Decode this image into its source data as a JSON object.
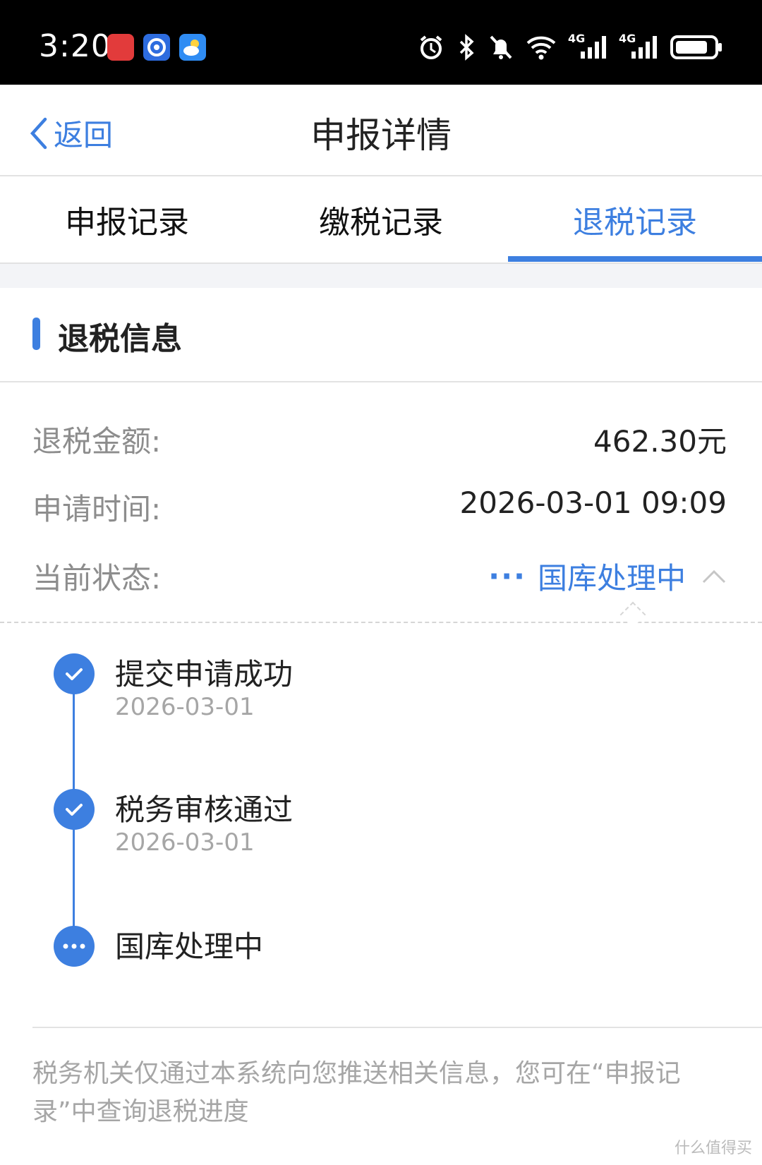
{
  "status_bar": {
    "time": "3:20",
    "apps": [
      {
        "icon": "huawei-app-icon",
        "color": "#e23b3b"
      },
      {
        "icon": "browser-app-icon",
        "color": "#2d6cdf"
      },
      {
        "icon": "weather-app-icon",
        "color": "#2f8cf3"
      }
    ],
    "icons": [
      "alarm-icon",
      "bluetooth-icon",
      "mute-icon",
      "wifi-icon",
      "signal-4g-icon",
      "signal-4g-icon",
      "battery-icon"
    ],
    "network_labels": [
      "4G",
      "4G"
    ]
  },
  "header": {
    "back_label": "返回",
    "title": "申报详情"
  },
  "tabs": [
    {
      "label": "申报记录",
      "active": false
    },
    {
      "label": "缴税记录",
      "active": false
    },
    {
      "label": "退税记录",
      "active": true
    }
  ],
  "section": {
    "title": "退税信息"
  },
  "info": {
    "amount_label": "退税金额:",
    "amount_value": "462.30元",
    "time_label": "申请时间:",
    "time_value": "2026-03-01 09:09",
    "status_label": "当前状态:",
    "status_value": "国库处理中",
    "status_dots": "···"
  },
  "timeline": [
    {
      "title": "提交申请成功",
      "date": "2026-03-01",
      "state": "done"
    },
    {
      "title": "税务审核通过",
      "date": "2026-03-01",
      "state": "done"
    },
    {
      "title": "国库处理中",
      "date": "",
      "state": "pending"
    }
  ],
  "note": "税务机关仅通过本系统向您推送相关信息，您可在“申报记录”中查询退税进度",
  "watermark": "什么值得买",
  "colors": {
    "accent": "#3d7fe0",
    "muted_text": "#8d8d8d",
    "light_text": "#a6a6a6"
  }
}
